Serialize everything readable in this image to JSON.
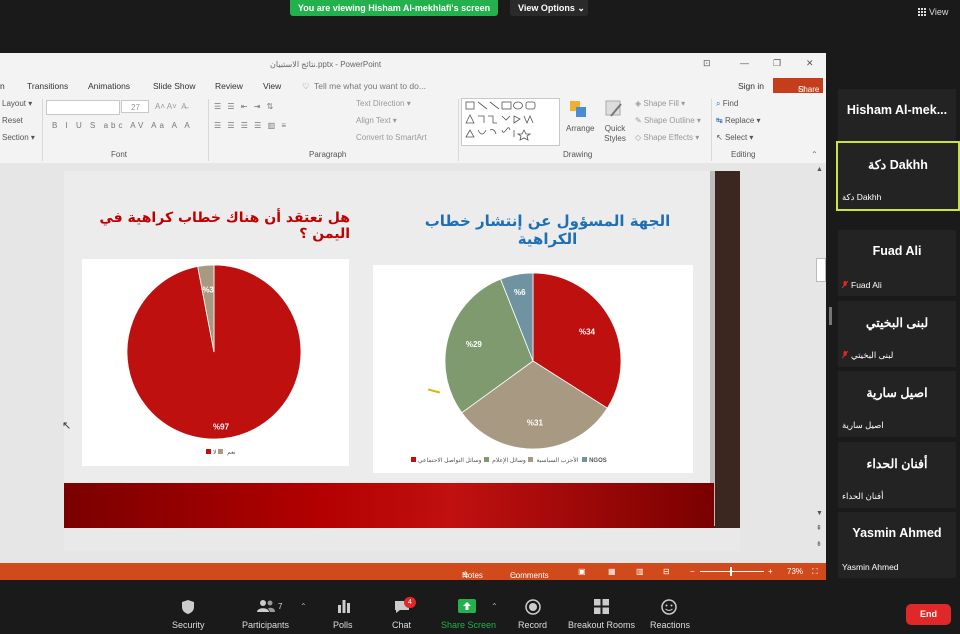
{
  "zoom_banner": {
    "viewing": "You are viewing Hisham Al-mekhlafi's screen",
    "view_options": "View Options",
    "view": "View"
  },
  "ppt": {
    "title": "نتائج الاستبيان.pptx - PowerPoint",
    "menu": [
      "n",
      "Transitions",
      "Animations",
      "Slide Show",
      "Review",
      "View"
    ],
    "tell_me": "Tell me what you want to do...",
    "sign_in": "Sign in",
    "share": "Share",
    "ribbon": {
      "layout": "Layout",
      "reset": "Reset",
      "section": "Section",
      "font_size": "27",
      "font_group": "Font",
      "text_direction": "Text Direction",
      "align_text": "Align Text",
      "convert_smartart": "Convert to SmartArt",
      "paragraph_group": "Paragraph",
      "arrange": "Arrange",
      "quick_styles": "Quick Styles",
      "shape_fill": "Shape Fill",
      "shape_outline": "Shape Outline",
      "shape_effects": "Shape Effects",
      "drawing_group": "Drawing",
      "find": "Find",
      "replace": "Replace",
      "select": "Select",
      "editing_group": "Editing"
    },
    "status": {
      "notes": "Notes",
      "comments": "Comments",
      "zoom": "73%"
    }
  },
  "slide": {
    "left_question": "هل تعتقد أن هناك خطاب كراهية في اليمن ؟",
    "right_question": "الجهة المسؤول عن إنتشار خطاب الكراهية",
    "left_legend": [
      "نعم",
      "لا"
    ],
    "right_legend": [
      "الأحزب السياسية",
      "وسائل الإعلام",
      "وسائل التواصل الاجتماعي",
      "NGOS"
    ]
  },
  "chart_data": [
    {
      "type": "pie",
      "title": "هل تعتقد أن هناك خطاب كراهية في اليمن ؟",
      "categories": [
        "نعم",
        "لا"
      ],
      "values": [
        97,
        3
      ],
      "labels": [
        "%97",
        "%3"
      ],
      "colors": [
        "#bf1010",
        "#a89a82"
      ]
    },
    {
      "type": "pie",
      "title": "الجهة المسؤول عن إنتشار خطاب الكراهية",
      "categories": [
        "الأحزب السياسية",
        "وسائل الإعلام",
        "وسائل التواصل الاجتماعي",
        "NGOS"
      ],
      "values": [
        34,
        31,
        29,
        6
      ],
      "labels": [
        "%34",
        "%31",
        "%29",
        "%6"
      ],
      "colors": [
        "#bf1010",
        "#a89a82",
        "#7e9a6e",
        "#6f93a0"
      ]
    }
  ],
  "participants": [
    {
      "display": "Hisham  Al-mek...",
      "name": "Hisham Al-mekhlafi",
      "muted": false,
      "active": false
    },
    {
      "display": "دكة  Dakhh",
      "name": "دكة Dakhh",
      "muted": false,
      "active": true
    },
    {
      "display": "Fuad Ali",
      "name": "Fuad Ali",
      "muted": true,
      "active": false
    },
    {
      "display": "لبنى البخيتي",
      "name": "لبنى البخيتي",
      "muted": true,
      "active": false
    },
    {
      "display": "اصيل سارية",
      "name": "اصيل سارية",
      "muted": false,
      "active": false
    },
    {
      "display": "أفنان الحداء",
      "name": "أفنان الحداء",
      "muted": false,
      "active": false
    },
    {
      "display": "Yasmin Ahmed",
      "name": "Yasmin Ahmed",
      "muted": false,
      "active": false
    }
  ],
  "toolbar": {
    "security": "Security",
    "participants": "Participants",
    "participants_count": "7",
    "polls": "Polls",
    "chat": "Chat",
    "chat_badge": "4",
    "share_screen": "Share Screen",
    "record": "Record",
    "breakout": "Breakout Rooms",
    "reactions": "Reactions",
    "end": "End"
  },
  "colors": {
    "zoom_green": "#22b14c",
    "ppt_orange": "#d04a1b",
    "end_red": "#e02828",
    "active_border": "#c8e63a"
  }
}
